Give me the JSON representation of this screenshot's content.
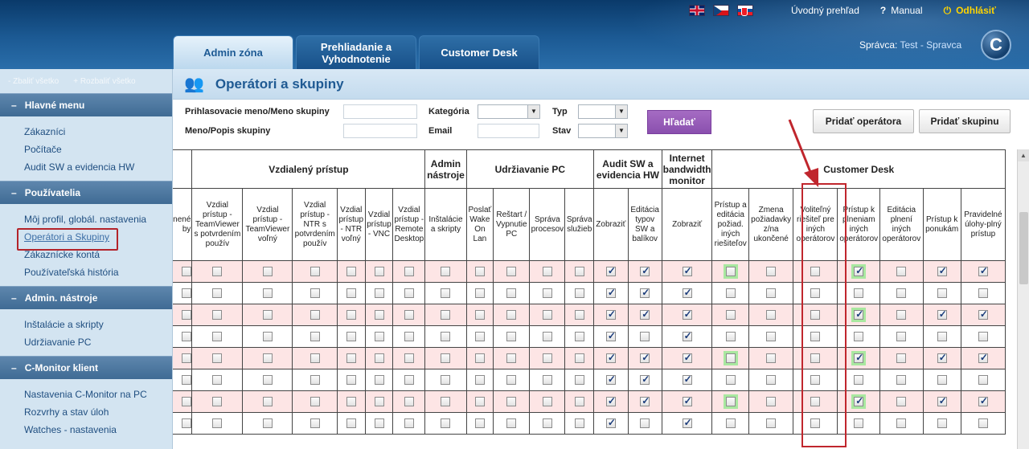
{
  "header": {
    "flags": [
      "flag-uk-icon",
      "flag-cz-icon",
      "flag-sk-icon"
    ],
    "overview_link": "Úvodný prehľad",
    "manual_link": "Manual",
    "logout_link": "Odhlásiť",
    "admin_label": "Správca:",
    "admin_name": "Test - Spravca",
    "logo_letter": "C"
  },
  "tabs": [
    {
      "label": "Admin zóna",
      "active": true
    },
    {
      "label": "Prehliadanie a Vyhodnotenie",
      "active": false
    },
    {
      "label": "Customer Desk",
      "active": false
    }
  ],
  "sidebar": {
    "collapse_all": "- Zbaliť všetko",
    "expand_all": "+ Rozbaliť všetko",
    "sections": [
      {
        "title": "Hlavné menu",
        "items": [
          "Zákazníci",
          "Počítače",
          "Audit SW a evidencia HW"
        ]
      },
      {
        "title": "Používatelia",
        "items": [
          "Môj profil, globál. nastavenia",
          "Operátori a Skupiny",
          "Zákaznícke kontá",
          "Používateľská história"
        ]
      },
      {
        "title": "Admin. nástroje",
        "items": [
          "Inštalácie a skripty",
          "Udržiavanie PC"
        ]
      },
      {
        "title": "C-Monitor klient",
        "items": [
          "Nastavenia C-Monitor na PC",
          "Rozvrhy a stav úloh",
          "Watches - nastavenia"
        ]
      }
    ],
    "selected_item": "Operátori a Skupiny"
  },
  "page": {
    "title": "Operátori a skupiny"
  },
  "filters": {
    "login_label": "Prihlasovacie meno/Meno skupiny",
    "name_label": "Meno/Popis skupiny",
    "category_label": "Kategória",
    "email_label": "Email",
    "type_label": "Typ",
    "state_label": "Stav",
    "search_button": "Hľadať",
    "add_operator_button": "Pridať operátora",
    "add_group_button": "Pridať skupinu"
  },
  "table": {
    "groups": [
      "Vzdialený prístup",
      "Admin nástroje",
      "Udržiavanie PC",
      "Audit SW a evidencia HW",
      "Internet bandwidth monitor",
      "Customer Desk"
    ],
    "first_col_header": "nené\nby",
    "columns": [
      "Vzdial prístup - TeamViewer s potvrdením použív",
      "Vzdial prístup - TeamViewer voľný",
      "Vzdial prístup - NTR s potvrdením použív",
      "Vzdial prístup - NTR voľný",
      "Vzdial prístup - VNC",
      "Vzdial prístup - Remote Desktop",
      "Inštalácie a skripty",
      "Poslať Wake On Lan",
      "Reštart / Vypnutie PC",
      "Správa procesov",
      "Správa služieb",
      "Zobraziť",
      "Editácia typov SW a balíkov",
      "Zobraziť",
      "Prístup a editácia požiad. iných riešiteľov",
      "Zmena požiadavky z/na ukončené",
      "Voliteľný riešiteľ pre iných operátorov",
      "Prístup k plneniam iných operátorov",
      "Editácia plnení iných operátorov",
      "Prístup k ponukám",
      "Pravidelné úlohy-plný prístup"
    ],
    "rows": [
      {
        "shade": "pink",
        "checks": [
          0,
          0,
          0,
          0,
          0,
          0,
          0,
          0,
          0,
          0,
          0,
          1,
          1,
          1,
          0,
          0,
          0,
          1,
          0,
          1,
          1
        ],
        "green": [
          14,
          17
        ]
      },
      {
        "shade": "white",
        "checks": [
          0,
          0,
          0,
          0,
          0,
          0,
          0,
          0,
          0,
          0,
          0,
          1,
          1,
          1,
          0,
          0,
          0,
          0,
          0,
          0,
          0
        ],
        "green": []
      },
      {
        "shade": "pink",
        "checks": [
          0,
          0,
          0,
          0,
          0,
          0,
          0,
          0,
          0,
          0,
          0,
          1,
          1,
          1,
          0,
          0,
          0,
          1,
          0,
          1,
          1
        ],
        "green": [
          17
        ]
      },
      {
        "shade": "white",
        "checks": [
          0,
          0,
          0,
          0,
          0,
          0,
          0,
          0,
          0,
          0,
          0,
          1,
          0,
          1,
          0,
          0,
          0,
          0,
          0,
          0,
          0
        ],
        "green": []
      },
      {
        "shade": "pink",
        "checks": [
          0,
          0,
          0,
          0,
          0,
          0,
          0,
          0,
          0,
          0,
          0,
          1,
          1,
          1,
          0,
          0,
          0,
          1,
          0,
          1,
          1
        ],
        "green": [
          14,
          17
        ]
      },
      {
        "shade": "white",
        "checks": [
          0,
          0,
          0,
          0,
          0,
          0,
          0,
          0,
          0,
          0,
          0,
          1,
          1,
          1,
          0,
          0,
          0,
          0,
          0,
          0,
          0
        ],
        "green": []
      },
      {
        "shade": "pink",
        "checks": [
          0,
          0,
          0,
          0,
          0,
          0,
          0,
          0,
          0,
          0,
          0,
          1,
          1,
          1,
          0,
          0,
          0,
          1,
          0,
          1,
          1
        ],
        "green": [
          14,
          17
        ]
      },
      {
        "shade": "white",
        "checks": [
          0,
          0,
          0,
          0,
          0,
          0,
          0,
          0,
          0,
          0,
          0,
          1,
          0,
          1,
          0,
          0,
          0,
          0,
          0,
          0,
          0
        ],
        "green": []
      }
    ]
  },
  "colors": {
    "accent": "#1f5a93",
    "highlight_red": "#c0262d",
    "row_pink": "#fde5e5",
    "search_purple": "#8a4fae",
    "logout_yellow": "#ffd400"
  }
}
